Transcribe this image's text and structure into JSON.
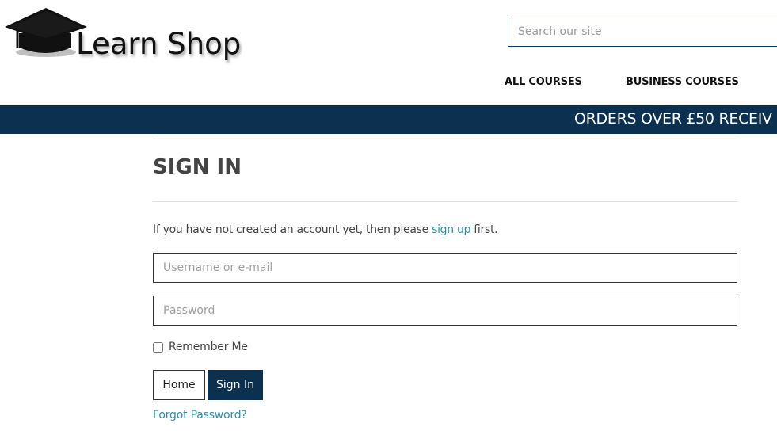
{
  "header": {
    "logo_text": "Learn Shop",
    "search_placeholder": "Search our site"
  },
  "nav": {
    "items": [
      {
        "label": "ALL COURSES"
      },
      {
        "label": "BUSINESS COURSES"
      }
    ]
  },
  "banner": {
    "text": "ORDERS OVER £50 RECEIV"
  },
  "signin": {
    "title": "SIGN IN",
    "intro_before": "If you have not created an account yet, then please ",
    "intro_link": "sign up",
    "intro_after": " first.",
    "username_placeholder": "Username or e-mail",
    "password_placeholder": "Password",
    "remember_label": "Remember Me",
    "home_button": "Home",
    "signin_button": "Sign In",
    "forgot_link": "Forgot Password?"
  },
  "colors": {
    "brand_navy": "#0b3050",
    "link_teal": "#2a8fa3"
  }
}
